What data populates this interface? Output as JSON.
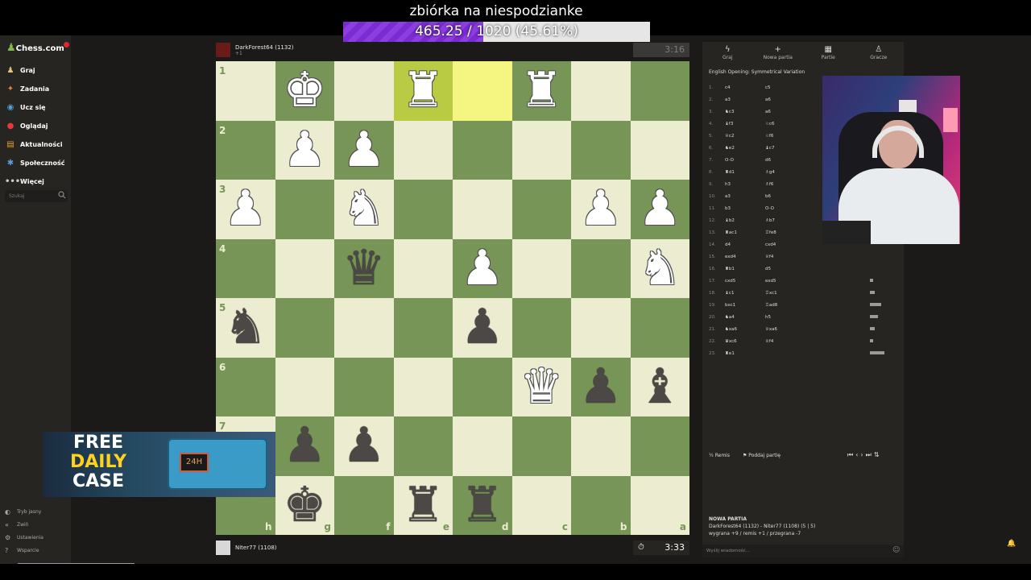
{
  "donation": {
    "title": "zbiórka na niespodzianke",
    "progress_text": "465.25 / 1020 (45.61%)",
    "percent": 45.61
  },
  "sidebar": {
    "logo": "Chess.com",
    "items": [
      {
        "label": "Graj",
        "icon": "pawn-icon",
        "color": "#e8c37a"
      },
      {
        "label": "Zadania",
        "icon": "puzzle-icon",
        "color": "#f07838"
      },
      {
        "label": "Ucz się",
        "icon": "learn-icon",
        "color": "#4da3d9"
      },
      {
        "label": "Oglądaj",
        "icon": "watch-icon",
        "color": "#e53a3a"
      },
      {
        "label": "Aktualności",
        "icon": "news-icon",
        "color": "#e8a038"
      },
      {
        "label": "Społeczność",
        "icon": "community-icon",
        "color": "#5aa0e0"
      },
      {
        "label": "Więcej",
        "icon": "more-icon",
        "color": "#cccccc"
      }
    ],
    "search_placeholder": "Szukaj",
    "bottom": [
      {
        "label": "Tryb jasny",
        "icon": "theme-icon"
      },
      {
        "label": "Zwiń",
        "icon": "collapse-icon"
      },
      {
        "label": "Ustawienia",
        "icon": "settings-icon"
      },
      {
        "label": "Wsparcie",
        "icon": "help-icon"
      }
    ]
  },
  "top_player": {
    "name": "DarkForest64 (1132)",
    "sub": "+1",
    "clock": "3:16"
  },
  "bottom_player": {
    "name": "Niter77 (1108)",
    "clock": "3:33"
  },
  "board": {
    "ranks": [
      "1",
      "2",
      "3",
      "4",
      "5",
      "6",
      "7",
      "8"
    ],
    "files": [
      "h",
      "g",
      "f",
      "e",
      "d",
      "c",
      "b",
      "a"
    ],
    "rows": [
      [
        "",
        "wK",
        "",
        "wR",
        "",
        "wR",
        "",
        ""
      ],
      [
        "",
        "wP",
        "wP",
        "",
        "",
        "",
        "",
        ""
      ],
      [
        "wP",
        "",
        "wN",
        "",
        "",
        "",
        "wP",
        "wP"
      ],
      [
        "",
        "",
        "bQ",
        "",
        "wP",
        "",
        "",
        "wN"
      ],
      [
        "bN",
        "",
        "",
        "",
        "bP",
        "",
        "",
        ""
      ],
      [
        "",
        "",
        "",
        "",
        "",
        "wQ",
        "bP",
        "bB"
      ],
      [
        "",
        "bP",
        "bP",
        "",
        "",
        "",
        "",
        ""
      ],
      [
        "",
        "bK",
        "",
        "bR",
        "bR",
        "",
        "",
        ""
      ]
    ],
    "highlights": [
      [
        0,
        3
      ],
      [
        0,
        4
      ]
    ]
  },
  "panel": {
    "tabs": [
      {
        "label": "Graj",
        "icon": "bolt-icon"
      },
      {
        "label": "Nowa partia",
        "icon": "plus-icon"
      },
      {
        "label": "Partie",
        "icon": "grid-icon"
      },
      {
        "label": "Gracze",
        "icon": "players-icon"
      }
    ],
    "opening": "English Opening: Symmetrical Variation",
    "moves": [
      [
        "1.",
        "c4",
        "c5"
      ],
      [
        "2.",
        "a3",
        "a6"
      ],
      [
        "3.",
        "♞c3",
        "a6"
      ],
      [
        "4.",
        "♝f3",
        "♘c6"
      ],
      [
        "5.",
        "♕c2",
        "♘f6"
      ],
      [
        "6.",
        "♞e2",
        "♝c7"
      ],
      [
        "7.",
        "O-O",
        "d6"
      ],
      [
        "8.",
        "♜d1",
        "♗g4"
      ],
      [
        "9.",
        "h3",
        "♗f6"
      ],
      [
        "10.",
        "a3",
        "b6"
      ],
      [
        "11.",
        "b3",
        "O-O"
      ],
      [
        "12.",
        "♝b2",
        "♗b7"
      ],
      [
        "13.",
        "♜ac1",
        "♖fe8"
      ],
      [
        "14.",
        "d4",
        "cxd4"
      ],
      [
        "15.",
        "exd4",
        "♕f4"
      ],
      [
        "16.",
        "♜b1",
        "d5"
      ],
      [
        "17.",
        "cxd5",
        "exd5"
      ],
      [
        "18.",
        "♝c1",
        "♖xc1"
      ],
      [
        "19.",
        "bxc1",
        "♖ad8"
      ],
      [
        "20.",
        "♞a4",
        "h5"
      ],
      [
        "21.",
        "♞xa6",
        "♕xa6"
      ],
      [
        "22.",
        "♛xc6",
        "♕f4"
      ],
      [
        "23.",
        "♜e1",
        ""
      ]
    ],
    "move_bars": [
      0,
      0,
      0,
      0,
      0,
      0,
      0,
      0,
      0,
      0,
      0,
      0,
      0,
      0,
      0,
      0,
      4,
      6,
      14,
      10,
      6,
      4,
      18
    ],
    "controls": {
      "draw": "Remis",
      "resign": "Poddaj partię"
    },
    "newgame": {
      "title": "NOWA PARTIA",
      "line1": "DarkForest64 (1132) - Niter77 (1108) (5 | 5)",
      "line2": "wygrana +9 / remis +1 / przegrana -7"
    },
    "chat_placeholder": "Wyślij wiadomość..."
  },
  "ad": {
    "line1": "FREE",
    "line2": "DAILY",
    "line3": "CASE",
    "timer": "24H"
  }
}
